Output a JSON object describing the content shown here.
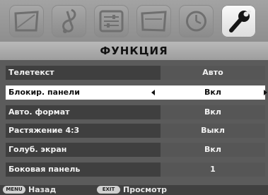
{
  "tabs": [
    {
      "icon": "picture-icon",
      "active": false
    },
    {
      "icon": "sound-note-icon",
      "active": false
    },
    {
      "icon": "settings-sliders-icon",
      "active": false
    },
    {
      "icon": "tv-screen-icon",
      "active": false
    },
    {
      "icon": "clock-icon",
      "active": false
    },
    {
      "icon": "wrench-icon",
      "active": true
    }
  ],
  "title": "ФУНКЦИЯ",
  "rows": [
    {
      "label": "Телетекст",
      "value": "Авто",
      "selected": false
    },
    {
      "label": "Блокир. панели",
      "value": "Вкл",
      "selected": true
    },
    {
      "label": "Авто. формат",
      "value": "Вкл",
      "selected": false
    },
    {
      "label": "Растяжение 4:3",
      "value": "Выкл",
      "selected": false
    },
    {
      "label": "Голуб. экран",
      "value": "Вкл",
      "selected": false
    },
    {
      "label": "Боковая панель",
      "value": "1",
      "selected": false
    }
  ],
  "footer": {
    "menu_key": "MENU",
    "menu_label": "Назад",
    "exit_key": "EXIT",
    "exit_label": "Просмотр"
  },
  "colors": {
    "background": "#5b5b5b",
    "row": "#3f3f3f",
    "value_cell": "#565656",
    "selected_row": "#ffffff"
  }
}
